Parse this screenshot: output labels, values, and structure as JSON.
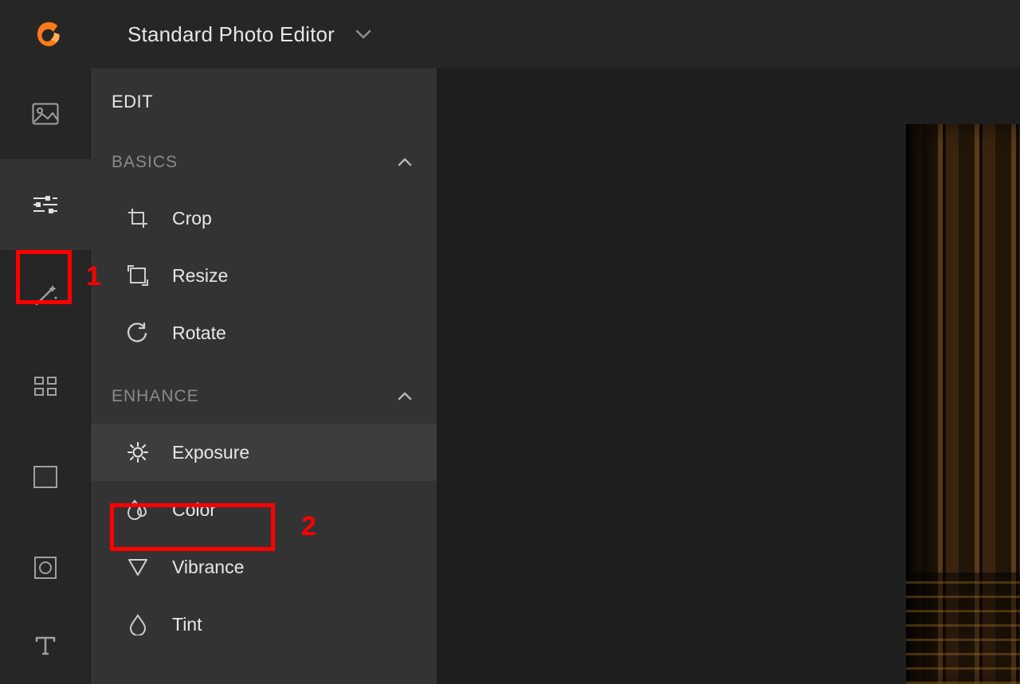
{
  "header": {
    "title": "Standard Photo Editor"
  },
  "panel": {
    "title": "EDIT",
    "sections": [
      {
        "title": "BASICS",
        "expanded": true,
        "items": [
          {
            "icon": "crop-icon",
            "label": "Crop"
          },
          {
            "icon": "resize-icon",
            "label": "Resize"
          },
          {
            "icon": "rotate-icon",
            "label": "Rotate"
          }
        ]
      },
      {
        "title": "ENHANCE",
        "expanded": true,
        "items": [
          {
            "icon": "exposure-icon",
            "label": "Exposure",
            "selected": true
          },
          {
            "icon": "color-icon",
            "label": "Color"
          },
          {
            "icon": "vibrance-icon",
            "label": "Vibrance"
          },
          {
            "icon": "tint-icon",
            "label": "Tint"
          }
        ]
      }
    ]
  },
  "rail": {
    "items": [
      {
        "name": "image-tab",
        "icon": "image-icon"
      },
      {
        "name": "adjust-tab",
        "icon": "sliders-icon",
        "active": true
      },
      {
        "name": "magic-tab",
        "icon": "wand-icon"
      },
      {
        "name": "apps-tab",
        "icon": "grid-icon"
      },
      {
        "name": "border-tab",
        "icon": "frame-icon"
      },
      {
        "name": "vignette-tab",
        "icon": "circle-frame-icon"
      },
      {
        "name": "text-tab",
        "icon": "text-icon"
      }
    ]
  },
  "annotations": {
    "1": "1",
    "2": "2"
  },
  "colors": {
    "accent": "#ff7a1a",
    "annotation": "#ff0000"
  }
}
